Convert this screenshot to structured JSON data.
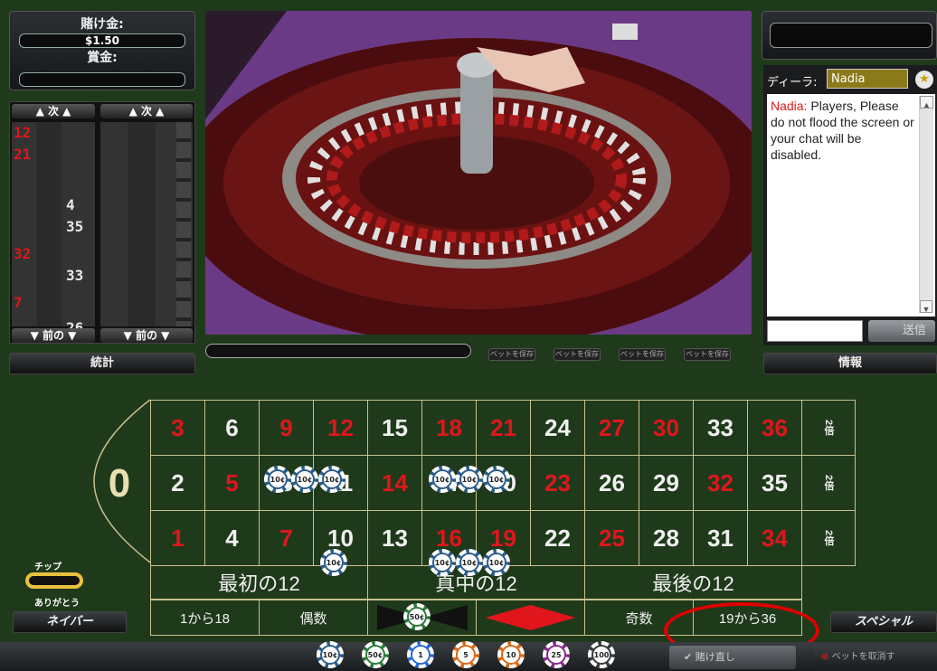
{
  "left_panel": {
    "bet_label": "賭け金:",
    "bet_value": "$1.50",
    "win_label": "賞金:",
    "win_value": "",
    "col1_header": "次",
    "col2_header": "次",
    "col1_footer": "前の",
    "col2_footer": "前の",
    "stats_label": "統計",
    "history": [
      {
        "n": "12",
        "c": "red",
        "side": "left"
      },
      {
        "n": "21",
        "c": "red",
        "side": "left"
      },
      {
        "n": "4",
        "c": "blk",
        "side": "right"
      },
      {
        "n": "35",
        "c": "blk",
        "side": "right"
      },
      {
        "n": "32",
        "c": "red",
        "side": "left"
      },
      {
        "n": "33",
        "c": "blk",
        "side": "right"
      },
      {
        "n": "7",
        "c": "red",
        "side": "left"
      },
      {
        "n": "26",
        "c": "blk",
        "side": "right"
      }
    ]
  },
  "right_panel": {
    "dealer_label": "ディーラ:",
    "dealer_name": "Nadia",
    "chat_author": "Nadia:",
    "chat_text": " Players, Please do not flood the screen or your chat will be disabled.",
    "send_label": "送信",
    "info_label": "情報"
  },
  "video_bar": {
    "save_buttons": [
      "ベットを保存",
      "ベットを保存",
      "ベットを保存",
      "ベットを保存"
    ]
  },
  "table": {
    "zero": "0",
    "rows": [
      [
        {
          "n": "3",
          "c": "red"
        },
        {
          "n": "6",
          "c": "blk"
        },
        {
          "n": "9",
          "c": "red"
        },
        {
          "n": "12",
          "c": "red"
        },
        {
          "n": "15",
          "c": "blk"
        },
        {
          "n": "18",
          "c": "red"
        },
        {
          "n": "21",
          "c": "red"
        },
        {
          "n": "24",
          "c": "blk"
        },
        {
          "n": "27",
          "c": "red"
        },
        {
          "n": "30",
          "c": "red"
        },
        {
          "n": "33",
          "c": "blk"
        },
        {
          "n": "36",
          "c": "red"
        }
      ],
      [
        {
          "n": "2",
          "c": "blk"
        },
        {
          "n": "5",
          "c": "red"
        },
        {
          "n": "8",
          "c": "blk"
        },
        {
          "n": "11",
          "c": "blk"
        },
        {
          "n": "14",
          "c": "red"
        },
        {
          "n": "17",
          "c": "blk"
        },
        {
          "n": "20",
          "c": "blk"
        },
        {
          "n": "23",
          "c": "red"
        },
        {
          "n": "26",
          "c": "blk"
        },
        {
          "n": "29",
          "c": "blk"
        },
        {
          "n": "32",
          "c": "red"
        },
        {
          "n": "35",
          "c": "blk"
        }
      ],
      [
        {
          "n": "1",
          "c": "red"
        },
        {
          "n": "4",
          "c": "blk"
        },
        {
          "n": "7",
          "c": "red"
        },
        {
          "n": "10",
          "c": "blk"
        },
        {
          "n": "13",
          "c": "blk"
        },
        {
          "n": "16",
          "c": "red"
        },
        {
          "n": "19",
          "c": "red"
        },
        {
          "n": "22",
          "c": "blk"
        },
        {
          "n": "25",
          "c": "red"
        },
        {
          "n": "28",
          "c": "blk"
        },
        {
          "n": "31",
          "c": "blk"
        },
        {
          "n": "34",
          "c": "red"
        }
      ]
    ],
    "column_bets": [
      "2倍",
      "2倍",
      "2倍"
    ],
    "dozens": [
      "最初の12",
      "真中の12",
      "最後の12"
    ],
    "outside": [
      "1から18",
      "偶数",
      "",
      "",
      "奇数",
      "19から36"
    ]
  },
  "chips_on_table": [
    {
      "label": "10¢"
    },
    {
      "label": "10¢"
    },
    {
      "label": "10¢"
    },
    {
      "label": "10¢"
    },
    {
      "label": "10¢"
    },
    {
      "label": "10¢"
    },
    {
      "label": "10¢"
    },
    {
      "label": "10¢"
    },
    {
      "label": "10¢"
    },
    {
      "label": "10¢"
    },
    {
      "label": "50¢"
    }
  ],
  "chip_tray": [
    {
      "label": "10¢",
      "color": "#2b5c8a"
    },
    {
      "label": "50¢",
      "color": "#2e7a3a"
    },
    {
      "label": "1",
      "color": "#2a6ad0"
    },
    {
      "label": "5",
      "color": "#d86a1a"
    },
    {
      "label": "10",
      "color": "#d86a1a"
    },
    {
      "label": "25",
      "color": "#8a2a8a"
    },
    {
      "label": "100",
      "color": "#3a3a3a"
    }
  ],
  "controls": {
    "tip_label": "チップ",
    "thanks_label": "ありがとう",
    "neighbor_label": "ネイバー",
    "special_label": "スペシャル",
    "rebet_label": "賭け直し",
    "clear_label": "ベットを取消す"
  },
  "colors": {
    "felt": "#1f3a1b",
    "red": "#e0161c",
    "highlight": "#e00000"
  }
}
